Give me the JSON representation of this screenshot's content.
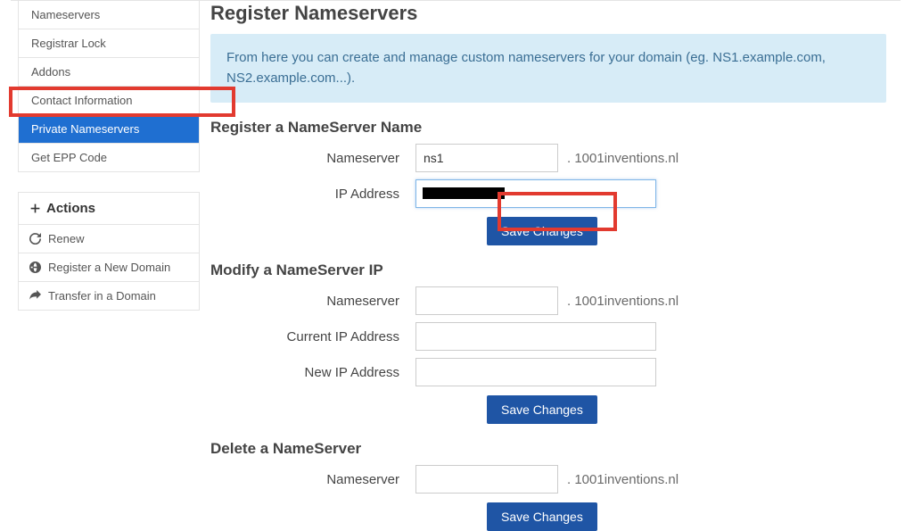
{
  "sidebar": {
    "items": [
      {
        "label": "Nameservers"
      },
      {
        "label": "Registrar Lock"
      },
      {
        "label": "Addons"
      },
      {
        "label": "Contact Information"
      },
      {
        "label": "Private Nameservers"
      },
      {
        "label": "Get EPP Code"
      }
    ],
    "actions_header": "Actions",
    "actions": [
      {
        "label": "Renew"
      },
      {
        "label": "Register a New Domain"
      },
      {
        "label": "Transfer in a Domain"
      }
    ]
  },
  "main": {
    "title": "Register Nameservers",
    "intro": "From here you can create and manage custom nameservers for your domain (eg. NS1.example.com, NS2.example.com...).",
    "domain_suffix": ". 1001inventions.nl",
    "register": {
      "heading": "Register a NameServer Name",
      "ns_label": "Nameserver",
      "ns_value": "ns1",
      "ip_label": "IP Address",
      "ip_value": "",
      "save": "Save Changes"
    },
    "modify": {
      "heading": "Modify a NameServer IP",
      "ns_label": "Nameserver",
      "current_ip_label": "Current IP Address",
      "new_ip_label": "New IP Address",
      "save": "Save Changes"
    },
    "delete": {
      "heading": "Delete a NameServer",
      "ns_label": "Nameserver",
      "save": "Save Changes"
    }
  }
}
